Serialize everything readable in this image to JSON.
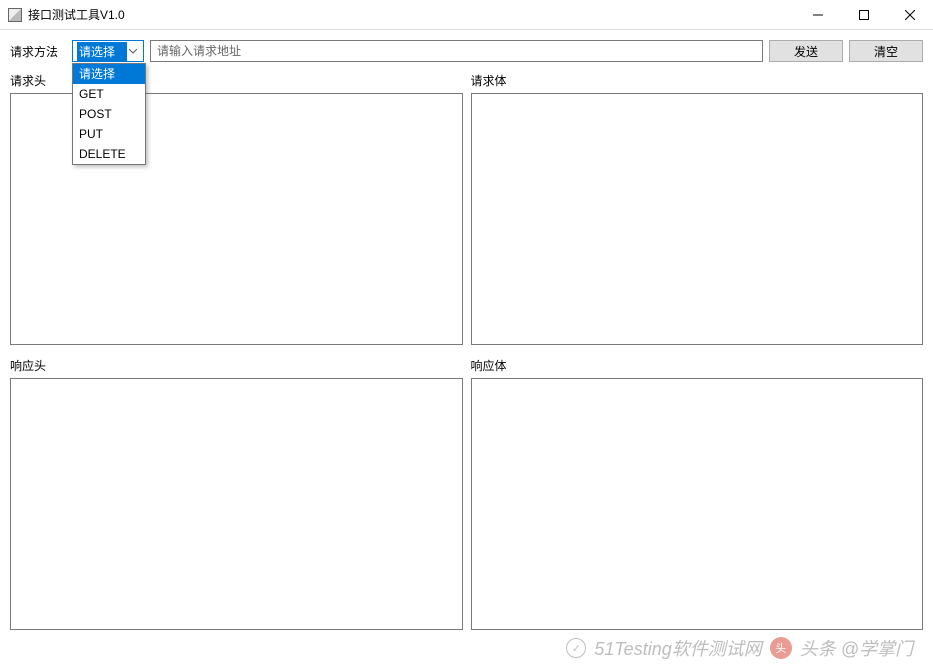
{
  "window": {
    "title": "接口测试工具V1.0"
  },
  "toolbar": {
    "method_label": "请求方法",
    "method_selected": "请选择",
    "method_options": [
      "请选择",
      "GET",
      "POST",
      "PUT",
      "DELETE"
    ],
    "url_placeholder": "请输入请求地址",
    "url_value": "",
    "send_label": "发送",
    "clear_label": "清空"
  },
  "panels": {
    "request_headers_label": "请求头",
    "request_body_label": "请求体",
    "response_headers_label": "响应头",
    "response_body_label": "响应体"
  },
  "watermark": {
    "text1": "51Testing软件测试网",
    "text2": "头条 @学掌门"
  }
}
